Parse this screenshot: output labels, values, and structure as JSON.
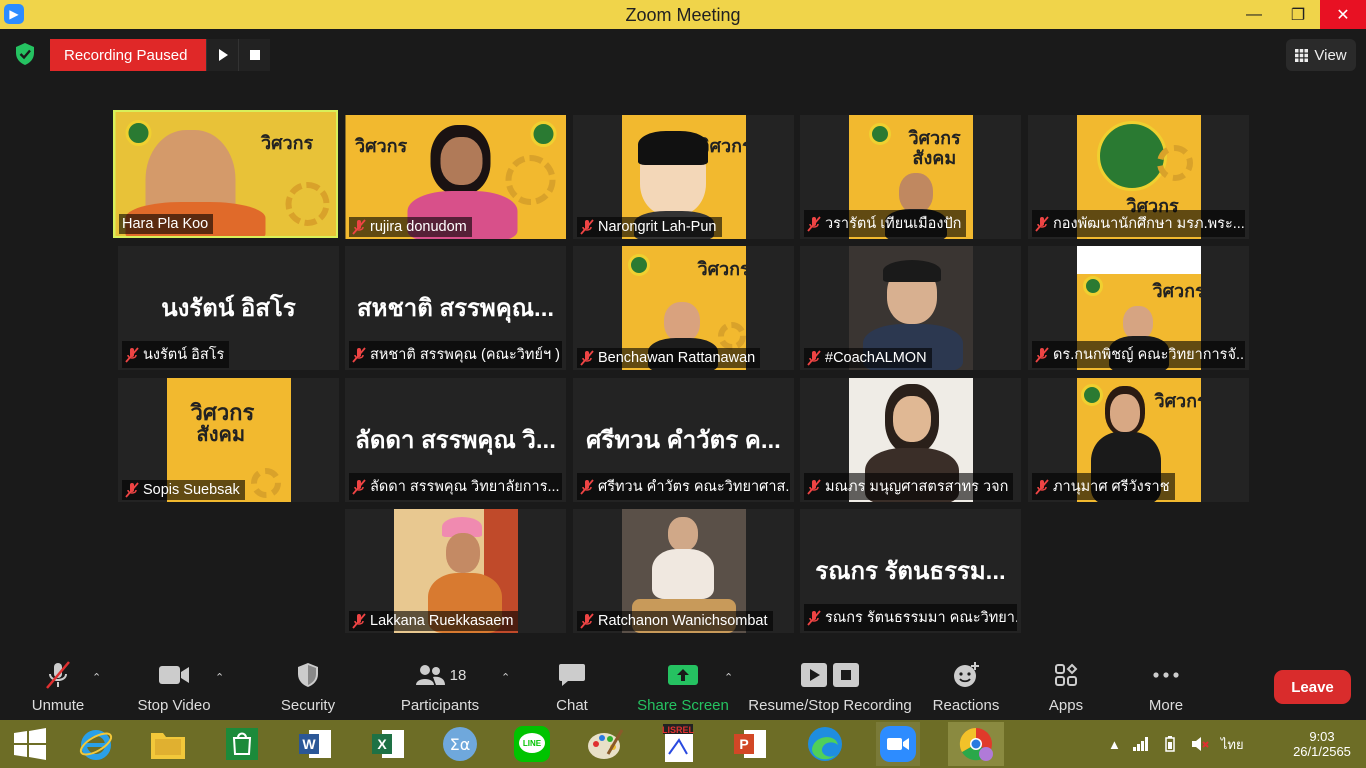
{
  "window": {
    "title": "Zoom Meeting",
    "minimize": "—",
    "maximize": "❐",
    "close": "✕"
  },
  "recording": {
    "status": "Recording Paused"
  },
  "view_button": {
    "label": "View"
  },
  "participants_tiles": [
    {
      "name": "Hara Pla Koo",
      "active": true,
      "muted": false
    },
    {
      "name": "rujira donudom",
      "muted": true
    },
    {
      "name": "Narongrit Lah-Pun",
      "muted": true
    },
    {
      "name": "วรารัตน์ เทียนเมืองปัก",
      "muted": true
    },
    {
      "name": "กองพัฒนานักศึกษา มรภ.พระ...",
      "muted": true
    },
    {
      "name": "นงรัตน์ อิสโร",
      "display": "นงรัตน์ อิสโร",
      "muted": true
    },
    {
      "name": "สหชาติ สรรพคุณ (คณะวิทย์ฯ )",
      "display": "สหชาติ สรรพคุณ...",
      "muted": true
    },
    {
      "name": "Benchawan Rattanawan",
      "muted": true
    },
    {
      "name": "#CoachALMON",
      "muted": true
    },
    {
      "name": "ดร.กนกพิชญ์ คณะวิทยาการจั...",
      "muted": true
    },
    {
      "name": "Sopis Suebsak",
      "muted": true
    },
    {
      "name": "ลัดดา สรรพคุณ วิทยาลัยการ...",
      "display": "ลัดดา สรรพคุณ วิ...",
      "muted": true
    },
    {
      "name": "ศรีทวน คำวัตร คณะวิทยาศาส...",
      "display": "ศรีทวน  คำวัตร ค...",
      "muted": true
    },
    {
      "name": "มณภร มนุญศาสตรสาทร วจก",
      "muted": true
    },
    {
      "name": "ภานุมาศ ศรีวังราช",
      "muted": true
    },
    {
      "name": "Lakkana Ruekkasaem",
      "muted": true
    },
    {
      "name": "Ratchanon Wanichsombat",
      "muted": true
    },
    {
      "name": "รณกร รัตนธรรมมา คณะวิทยา...",
      "display": "รณกร รัตนธรรม...",
      "muted": true
    }
  ],
  "poster": {
    "line1": "วิศวกร",
    "line2": "สังคม"
  },
  "toolbar": {
    "unmute": "Unmute",
    "stop_video": "Stop Video",
    "security": "Security",
    "participants": "Participants",
    "participants_count": "18",
    "chat": "Chat",
    "share_screen": "Share Screen",
    "recording": "Resume/Stop Recording",
    "reactions": "Reactions",
    "apps": "Apps",
    "more": "More",
    "leave": "Leave"
  },
  "taskbar": {
    "language": "ไทย",
    "time": "9:03",
    "date": "26/1/2565"
  },
  "colors": {
    "accent_green": "#25c261",
    "leave_red": "#d92c2c",
    "title_yellow": "#f0d44a",
    "active_border": "#d8f05a"
  }
}
